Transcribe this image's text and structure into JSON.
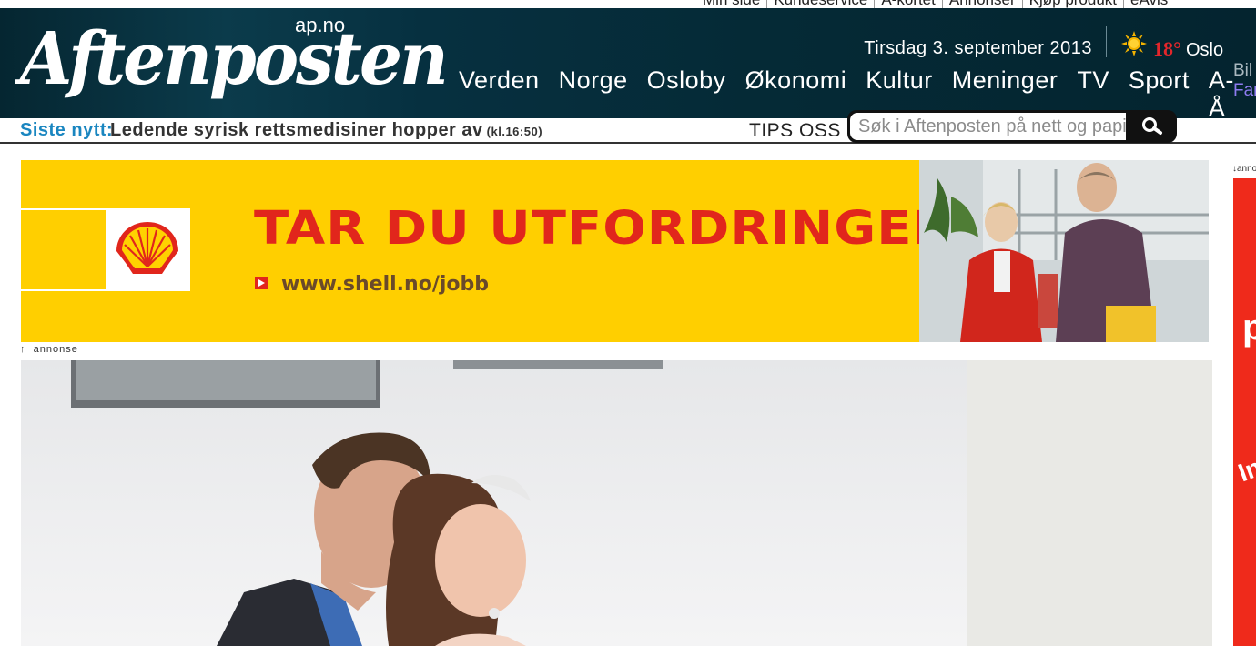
{
  "top_links": [
    "Min side",
    "Kundeservice",
    "A-kortet",
    "Annonser",
    "Kjøp produkt",
    "eAvis"
  ],
  "header": {
    "logo_text": "Aftenposten",
    "logo_suffix": "ap.no",
    "date": "Tirsdag 3. september 2013",
    "weather": {
      "temperature": "18°",
      "city": "Oslo",
      "icon": "sun-icon"
    },
    "nav": [
      "Verden",
      "Norge",
      "Osloby",
      "Økonomi",
      "Kultur",
      "Meninger",
      "TV",
      "Sport",
      "A-Å"
    ],
    "extra_links": [
      "Bil",
      "Fam"
    ]
  },
  "newsbar": {
    "label": "Siste nytt:",
    "headline": "Ledende syrisk rettsmedisiner hopper av",
    "time": "(kl.16:50)",
    "tips": "TIPS OSS"
  },
  "search": {
    "placeholder": "Søk i Aftenposten på nett og papir",
    "icon": "search-icon"
  },
  "ad_banner": {
    "headline": "TAR DU UTFORDRINGEN?",
    "url": "www.shell.no/jobb",
    "brand_icon": "shell-logo",
    "label": "annonse",
    "colors": {
      "background": "#ffcf00",
      "text": "#e1261c"
    }
  },
  "side_ad": {
    "label": "annonse",
    "text_p": "p",
    "text_in": "In"
  },
  "colors": {
    "header_bg": "#052a36",
    "siste_nytt": "#1a86c0",
    "temperature": "#e3262b"
  }
}
